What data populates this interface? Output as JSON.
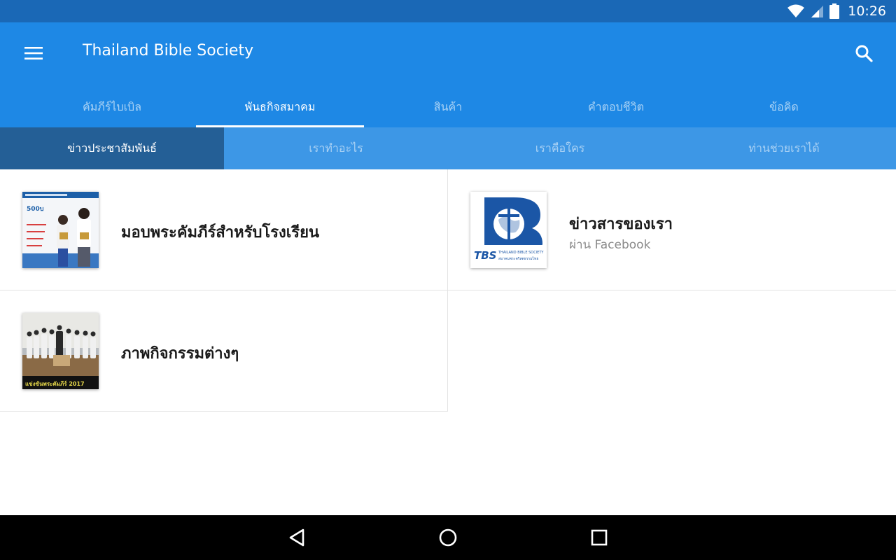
{
  "status_bar": {
    "time": "10:26",
    "icons": [
      "wifi-icon",
      "cellular-signal-icon",
      "battery-icon"
    ]
  },
  "app_bar": {
    "title": "Thailand Bible Society",
    "menu_icon": "hamburger-menu-icon",
    "search_icon": "search-icon",
    "color": "#1e88e5"
  },
  "main_tabs": [
    {
      "label": "คัมภีร์ไบเบิล",
      "active": false
    },
    {
      "label": "พันธกิจสมาคม",
      "active": true
    },
    {
      "label": "สินค้า",
      "active": false
    },
    {
      "label": "คำตอบชีวิต",
      "active": false
    },
    {
      "label": "ข้อคิด",
      "active": false
    }
  ],
  "sub_tabs": [
    {
      "label": "ข่าวประชาสัมพันธ์",
      "active": true
    },
    {
      "label": "เราทำอะไร",
      "active": false
    },
    {
      "label": "เราคือใคร",
      "active": false
    },
    {
      "label": "ท่านช่วยเราได้",
      "active": false
    }
  ],
  "items": [
    {
      "title": "มอบพระคัมภีร์สำหรับโรงเรียน",
      "subtitle": "",
      "thumb": "school-bible-photo",
      "thumb_text": "500บ"
    },
    {
      "title": "ข่าวสารของเรา",
      "subtitle": "ผ่าน Facebook",
      "thumb": "tbs-logo",
      "logo_text": {
        "mark": "TBS",
        "line1": "THAILAND BIBLE SOCIETY",
        "line2": "สมาคมพระคริสตธรรมไทย"
      }
    },
    {
      "title": "ภาพกิจกรรมต่างๆ",
      "subtitle": "",
      "thumb": "activity-group-photo",
      "thumb_caption": "แข่งขันพระคัมภีร์ 2017"
    }
  ],
  "nav_bar": {
    "icons": [
      "back-icon",
      "home-icon",
      "recents-icon"
    ]
  }
}
